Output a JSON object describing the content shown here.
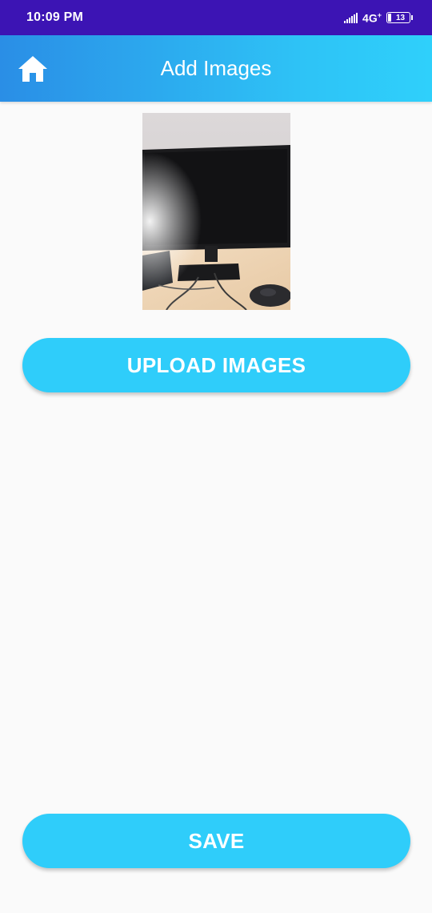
{
  "status_bar": {
    "time": "10:09 PM",
    "network": "4G",
    "battery": "13"
  },
  "app_bar": {
    "title": "Add Images",
    "home_icon": "home-icon"
  },
  "preview_image": {
    "subject": "monitor-on-desk-photo"
  },
  "buttons": {
    "upload_label": "UPLOAD IMAGES",
    "save_label": "SAVE"
  },
  "colors": {
    "status_bar": "#3c14b4",
    "app_bar_start": "#2a8ee6",
    "app_bar_end": "#2fd0fb",
    "button": "#2fcdfa",
    "background": "#fafafa"
  }
}
